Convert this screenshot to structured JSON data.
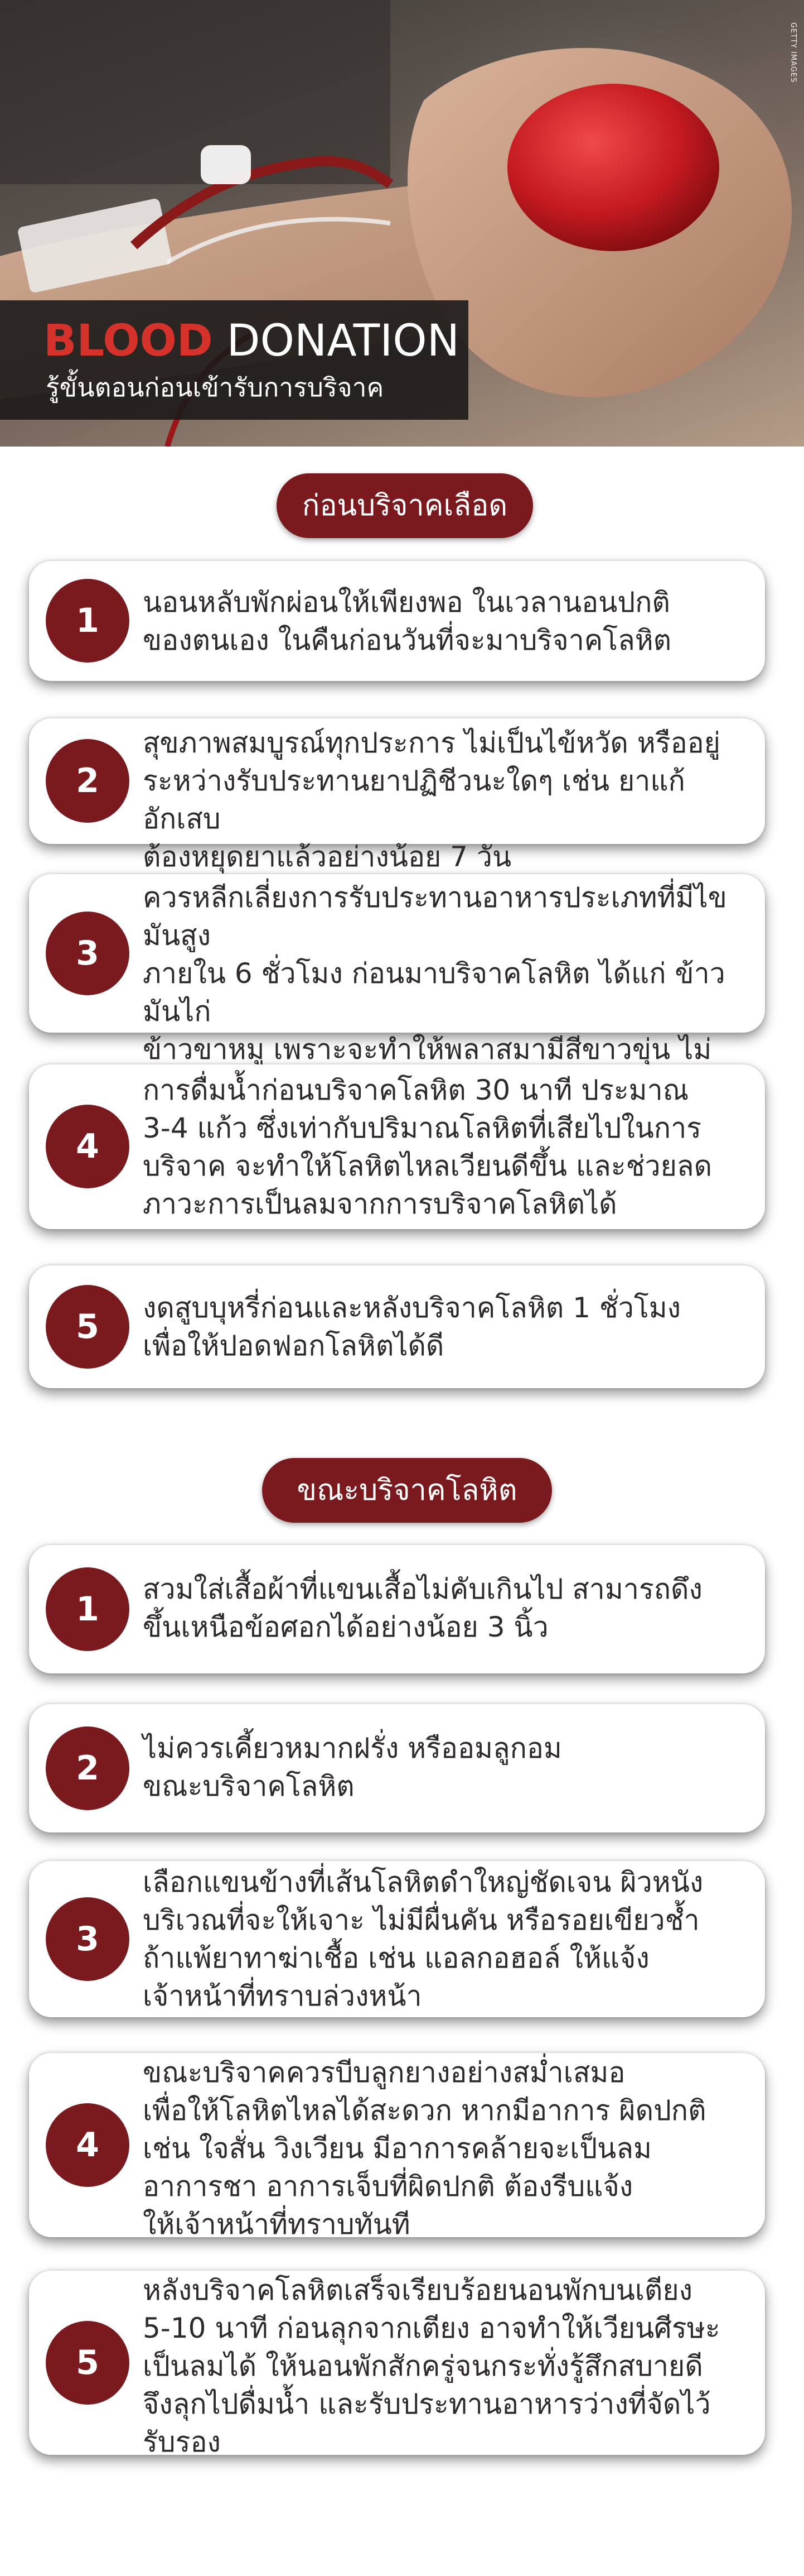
{
  "hero": {
    "title_red": "BLOOD",
    "title_white": " DONATION",
    "subtitle": "รู้ขั้นตอนก่อนเข้ารับการบริจาค",
    "credit": "GETTY IMAGES"
  },
  "sections": [
    {
      "heading": "ก่อนบริจาคเลือด",
      "steps": [
        {
          "number": "1",
          "text": "นอนหลับพักผ่อนให้เพียงพอ  ในเวลานอนปกติ\nของตนเอง ในคืนก่อนวันที่จะมาบริจาคโลหิต"
        },
        {
          "number": "2",
          "text": "สุขภาพสมบูรณ์ทุกประการ ไม่เป็นไข้หวัด หรืออยู่\nระหว่างรับประทานยาปฏิชีวนะใดๆ เช่น ยาแก้อักเสบ\nต้องหยุดยาแล้วอย่างน้อย 7 วัน"
        },
        {
          "number": "3",
          "text": "ควรหลีกเลี่ยงการรับประทานอาหารประเภทที่มีไขมันสูง\nภายใน 6 ชั่วโมง ก่อนมาบริจาคโลหิต ได้แก่ ข้าวมันไก่\nข้าวขาหมู   เพราะจะทำให้พลาสมามีสีขาวขุ่น ไม่สามารถ\nนำไปใช้รักษาผู้ป่วยได้"
        },
        {
          "number": "4",
          "text": "การดื่มน้ำก่อนบริจาคโลหิต 30 นาที ประมาณ\n3-4 แก้ว ซึ่งเท่ากับปริมาณโลหิตที่เสียไปในการ\nบริจาค จะทำให้โลหิตไหลเวียนดีขึ้น และช่วยลด\nภาวะการเป็นลมจากการบริจาคโลหิตได้"
        },
        {
          "number": "5",
          "text": "งดสูบบุหรี่ก่อนและหลังบริจาคโลหิต 1 ชั่วโมง\nเพื่อให้ปอดฟอกโลหิตได้ดี"
        }
      ]
    },
    {
      "heading": "ขณะบริจาคโลหิต",
      "steps": [
        {
          "number": "1",
          "text": "สวมใส่เสื้อผ้าที่แขนเสื้อไม่คับเกินไป สามารถดึง\nขึ้นเหนือข้อศอกได้อย่างน้อย 3 นิ้ว"
        },
        {
          "number": "2",
          "text": "ไม่ควรเคี้ยวหมากฝรั่ง หรืออมลูกอม\nขณะบริจาคโลหิต"
        },
        {
          "number": "3",
          "text": "เลือกแขนข้างที่เส้นโลหิตดำใหญ่ชัดเจน ผิวหนัง\nบริเวณที่จะให้เจาะ ไม่มีผื่นคัน หรือรอยเขียวช้ำ\nถ้าแพ้ยาทาฆ่าเชื้อ เช่น แอลกอฮอล์ ให้แจ้ง\nเจ้าหน้าที่ทราบล่วงหน้า"
        },
        {
          "number": "4",
          "text": "ขณะบริจาคควรบีบลูกยางอย่างสม่ำเสมอ\nเพื่อให้โลหิตไหลได้สะดวก หากมีอาการ ผิดปกติ\nเช่น ใจสั่น วิงเวียน มีอาการคล้ายจะเป็นลม\nอาการชา อาการเจ็บที่ผิดปกติ ต้องรีบแจ้ง\nให้เจ้าหน้าที่ทราบทันที"
        },
        {
          "number": "5",
          "text": "หลังบริจาคโลหิตเสร็จเรียบร้อยนอนพักบนเตียง\n5-10 นาที ก่อนลุกจากเตียง  อาจทำให้เวียนศีรษะ\nเป็นลมได้ ให้นอนพักสักครู่จนกระทั่งรู้สึกสบายดี\nจึงลุกไปดื่มน้ำ และรับประทานอาหารว่างที่จัดไว้\nรับรอง"
        }
      ]
    }
  ]
}
